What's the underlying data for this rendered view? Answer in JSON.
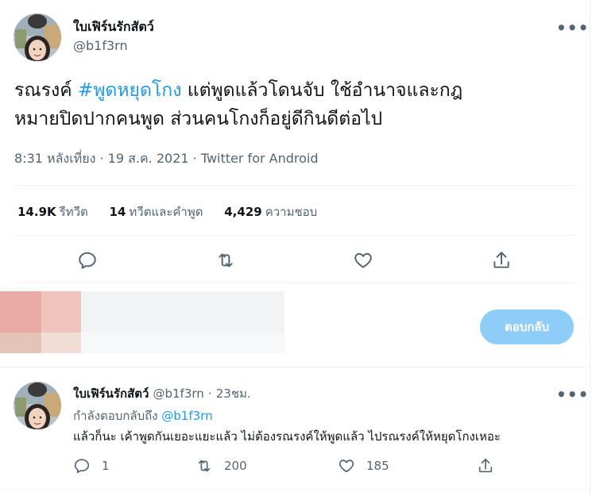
{
  "main_tweet": {
    "display_name": "ใบเฟิร์นรักสัตว์",
    "handle": "@b1f3rn",
    "text_before": "รณรงค์ ",
    "hashtag": "#พูดหยุดโกง",
    "text_line1_after": " แต่พูดแล้วโดนจับ ใช้อำนาจและกฎ",
    "text_line2": "หมายปิดปากคนพูด ส่วนคนโกงก็อยู่ดีกินดีต่อไป",
    "time": "8:31 หลังเที่ยง",
    "date": "19 ส.ค. 2021",
    "source": "Twitter for Android",
    "separator": "·",
    "more_label": "•••"
  },
  "stats": {
    "retweets_count": "14.9K",
    "retweets_label": "รีทวีต",
    "quotes_count": "14",
    "quotes_label": "ทวีตและคำพูด",
    "likes_count": "4,429",
    "likes_label": "ความชอบ"
  },
  "actions": [
    "reply-icon",
    "retweet-icon",
    "heart-icon",
    "share-icon"
  ],
  "reply_composer": {
    "button_label": "ตอบกลับ"
  },
  "reply_tweet": {
    "display_name": "ใบเฟิร์นรักสัตว์",
    "handle": "@b1f3rn",
    "time_ago": "23ชม.",
    "separator": "·",
    "replying_to_label": "กำลังตอบกลับถึง",
    "replying_to_mention": "@b1f3rn",
    "text": "แล้วก็นะ เค้าพูดกันเยอะแยะแล้ว ไม่ต้องรณรงค์ให้พูดแล้ว ไปรณรงค์ให้หยุดโกงเหอะ",
    "reply_count": "1",
    "retweet_count": "200",
    "like_count": "185",
    "more_label": "•••"
  },
  "colors": {
    "accent": "#1d9bf0",
    "secondary_text": "#536471",
    "divider": "#eff3f4",
    "reply_button_disabled": "#8ecdf8"
  }
}
